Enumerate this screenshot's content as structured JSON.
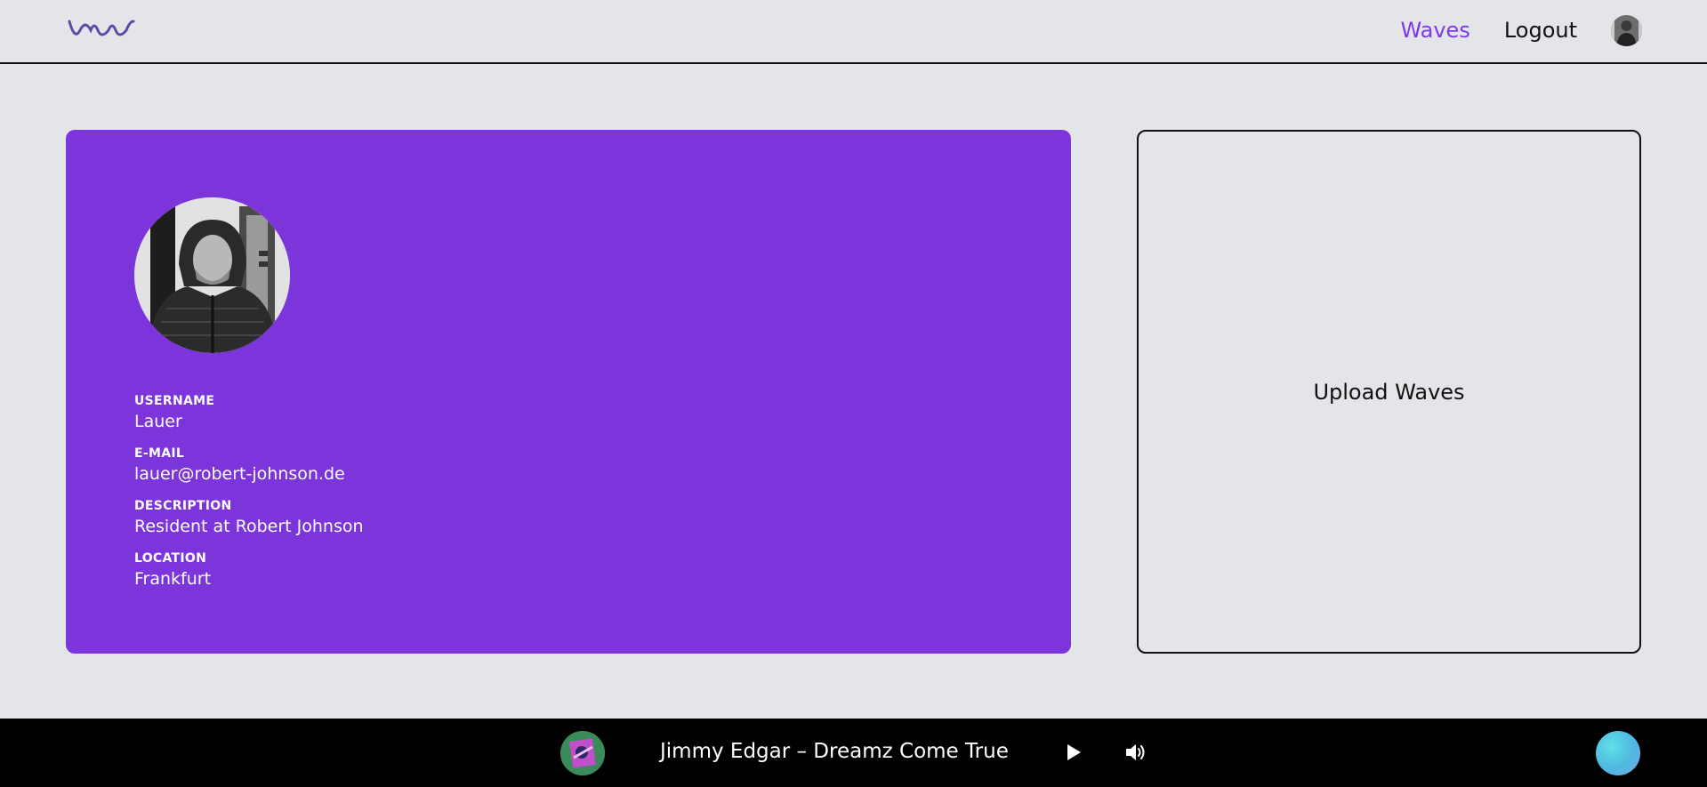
{
  "header": {
    "logo_icon": "wave-logo-icon",
    "nav": {
      "waves_label": "Waves",
      "logout_label": "Logout",
      "avatar_icon": "user-avatar"
    }
  },
  "profile": {
    "photo_icon": "profile-photo",
    "fields": [
      {
        "label": "USERNAME",
        "value": "Lauer"
      },
      {
        "label": "E-MAIL",
        "value": "lauer@robert-johnson.de"
      },
      {
        "label": "DESCRIPTION",
        "value": "Resident at Robert Johnson"
      },
      {
        "label": "LOCATION",
        "value": "Frankfurt"
      }
    ]
  },
  "upload": {
    "label": "Upload Waves"
  },
  "player": {
    "cover_icon": "album-cover",
    "track_title": "Jimmy Edgar – Dreamz Come True",
    "play_icon": "play-icon",
    "volume_icon": "volume-icon",
    "orb_icon": "gradient-orb-button"
  },
  "colors": {
    "accent": "#7c3aed",
    "card": "#7c34db",
    "background": "#e4e5e8",
    "player_bg": "#000000"
  }
}
